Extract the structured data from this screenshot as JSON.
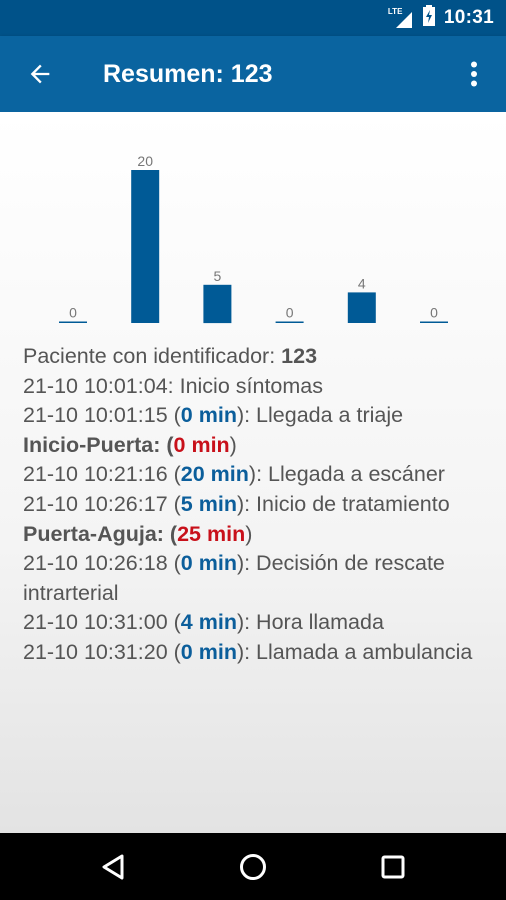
{
  "status_bar": {
    "network_label": "LTE",
    "time": "10:31",
    "icons": [
      "signal-icon",
      "battery-icon"
    ]
  },
  "app_bar": {
    "title": "Resumen: 123",
    "back_icon": "arrow-back-icon",
    "menu_icon": "more-vert-icon"
  },
  "chart_data": {
    "type": "bar",
    "categories": [
      "",
      "",
      "",
      "",
      "",
      ""
    ],
    "values": [
      0,
      20,
      5,
      0,
      4,
      0
    ],
    "title": "",
    "xlabel": "",
    "ylabel": "",
    "ylim": [
      0,
      20
    ],
    "grid": false,
    "bar_color": "#005a96"
  },
  "summary": {
    "patient_prefix": "Paciente con identificador: ",
    "patient_id": "123",
    "line1": "21-10 10:01:04: Inicio síntomas",
    "line2_time": "21-10 10:01:15 (",
    "line2_dur": "0 min",
    "line2_rest": "): Llegada a triaje",
    "door_label": "Inicio-Puerta: (",
    "door_value": "0 min",
    "door_close": ")",
    "line3_time": "21-10 10:21:16 (",
    "line3_dur": "20 min",
    "line3_rest": "): Llegada a escáner",
    "line4_time": "21-10 10:26:17 (",
    "line4_dur": "5 min",
    "line4_rest": "): Inicio de tratamiento",
    "needle_label": "Puerta-Aguja: (",
    "needle_value": "25 min",
    "needle_close": ")",
    "line5_time": "21-10 10:26:18 (",
    "line5_dur": "0 min",
    "line5_rest": "): Decisión de rescate intrarterial",
    "line6_time": "21-10 10:31:00 (",
    "line6_dur": "4 min",
    "line6_rest": "): Hora llamada",
    "line7_time": "21-10 10:31:20 (",
    "line7_dur": "0 min",
    "line7_rest": "): Llamada a ambulancia"
  },
  "colors": {
    "primary": "#0a64a0",
    "primary_dark": "#005289",
    "accent_blue": "#0b5e9b",
    "accent_red": "#c8101a"
  },
  "nav_bar": {
    "icons": [
      "back-triangle-icon",
      "home-circle-icon",
      "recents-square-icon"
    ]
  }
}
